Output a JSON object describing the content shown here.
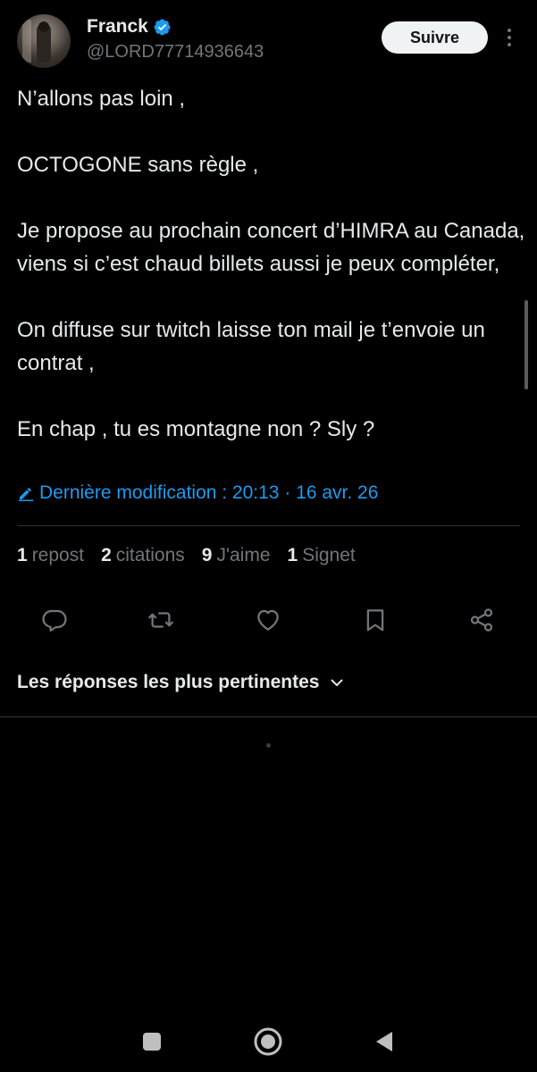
{
  "author": {
    "name": "Franck",
    "handle": "@LORD77714936643",
    "verified_color": "#1d9bf0"
  },
  "follow_button": {
    "label": "Suivre"
  },
  "tweet": {
    "paragraphs": [
      "N’allons pas loin ,",
      "OCTOGONE sans règle ,",
      "Je propose au prochain concert d’HIMRA au Canada, viens si c’est chaud billets aussi je peux compléter,",
      "On diffuse sur twitch laisse ton mail je t’envoie un contrat ,",
      "En chap , tu es montagne non ? Sly ?"
    ],
    "edited_label": "Dernière modification : 20:13 · 16 avr. 26"
  },
  "stats": {
    "reposts": {
      "count": "1",
      "label": "repost"
    },
    "quotes": {
      "count": "2",
      "label": "citations"
    },
    "likes": {
      "count": "9",
      "label": "J'aime"
    },
    "bookmarks": {
      "count": "1",
      "label": "Signet"
    }
  },
  "actions": {
    "icons": [
      "reply-icon",
      "repost-icon",
      "like-icon",
      "bookmark-icon",
      "share-icon"
    ]
  },
  "replies": {
    "sort_label": "Les réponses les plus pertinentes"
  },
  "colors": {
    "background": "#000000",
    "text_primary": "#e7e9ea",
    "text_secondary": "#71767b",
    "accent": "#1d9bf0",
    "divider": "#2f3336"
  },
  "system_nav": {
    "icons": [
      "recents-icon",
      "home-icon",
      "back-icon"
    ]
  }
}
